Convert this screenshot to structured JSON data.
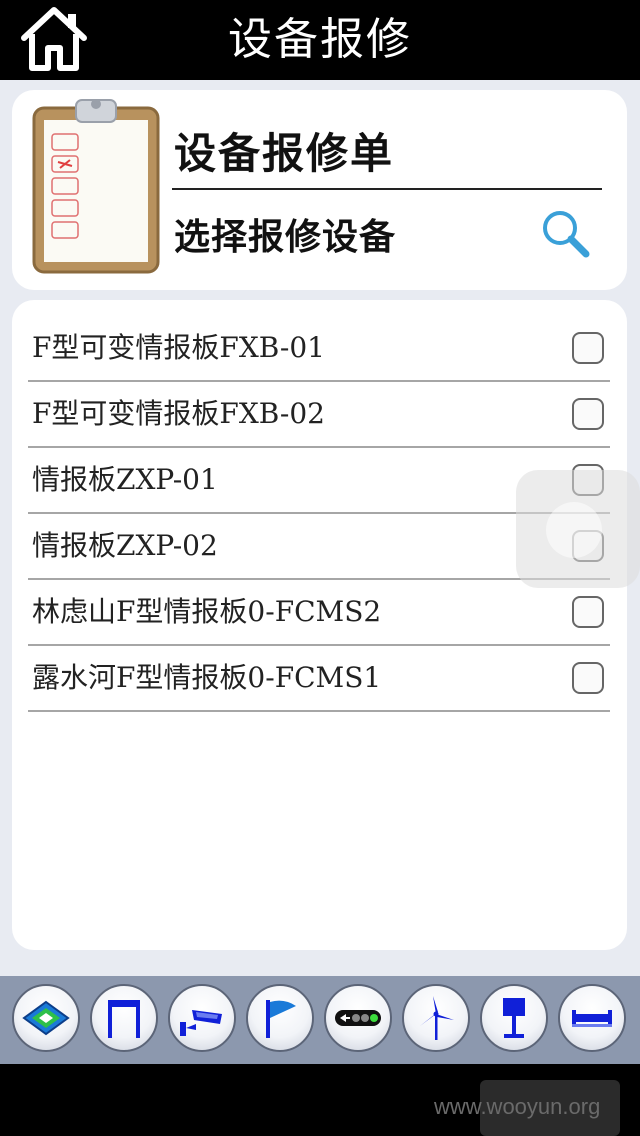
{
  "header": {
    "title": "设备报修",
    "home_icon": "home-icon"
  },
  "form": {
    "title": "设备报修单",
    "subtitle": "选择报修设备",
    "clipboard_icon": "clipboard-icon",
    "search_icon": "search-icon"
  },
  "devices": [
    {
      "name": "F型可变情报板FXB-01",
      "checked": false
    },
    {
      "name": "F型可变情报板FXB-02",
      "checked": false
    },
    {
      "name": "情报板ZXP-01",
      "checked": false
    },
    {
      "name": "情报板ZXP-02",
      "checked": false
    },
    {
      "name": "林虑山F型情报板0-FCMS2",
      "checked": false
    },
    {
      "name": "露水河F型情报板0-FCMS1",
      "checked": false
    }
  ],
  "toolbar": {
    "icons": [
      "layers-icon",
      "gantry-icon",
      "camera-icon",
      "flag-icon",
      "traffic-light-icon",
      "wind-turbine-icon",
      "sign-post-icon",
      "overpass-icon"
    ]
  },
  "footer": {
    "watermark": "www.wooyun.org"
  },
  "colors": {
    "header_bg": "#000000",
    "page_bg": "#e8ebf2",
    "toolbar_bg": "#8c98ae",
    "icon_blue": "#1020d8",
    "search_blue": "#3aa0d8"
  }
}
